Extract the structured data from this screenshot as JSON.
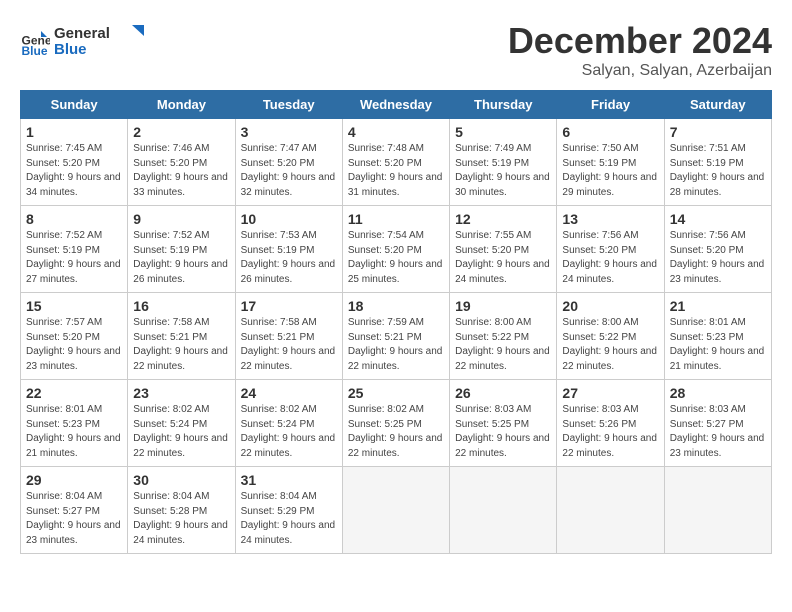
{
  "header": {
    "logo_general": "General",
    "logo_blue": "Blue",
    "month": "December 2024",
    "location": "Salyan, Salyan, Azerbaijan"
  },
  "days_of_week": [
    "Sunday",
    "Monday",
    "Tuesday",
    "Wednesday",
    "Thursday",
    "Friday",
    "Saturday"
  ],
  "weeks": [
    [
      {
        "day": "1",
        "info": "Sunrise: 7:45 AM\nSunset: 5:20 PM\nDaylight: 9 hours and 34 minutes."
      },
      {
        "day": "2",
        "info": "Sunrise: 7:46 AM\nSunset: 5:20 PM\nDaylight: 9 hours and 33 minutes."
      },
      {
        "day": "3",
        "info": "Sunrise: 7:47 AM\nSunset: 5:20 PM\nDaylight: 9 hours and 32 minutes."
      },
      {
        "day": "4",
        "info": "Sunrise: 7:48 AM\nSunset: 5:20 PM\nDaylight: 9 hours and 31 minutes."
      },
      {
        "day": "5",
        "info": "Sunrise: 7:49 AM\nSunset: 5:19 PM\nDaylight: 9 hours and 30 minutes."
      },
      {
        "day": "6",
        "info": "Sunrise: 7:50 AM\nSunset: 5:19 PM\nDaylight: 9 hours and 29 minutes."
      },
      {
        "day": "7",
        "info": "Sunrise: 7:51 AM\nSunset: 5:19 PM\nDaylight: 9 hours and 28 minutes."
      }
    ],
    [
      {
        "day": "8",
        "info": "Sunrise: 7:52 AM\nSunset: 5:19 PM\nDaylight: 9 hours and 27 minutes."
      },
      {
        "day": "9",
        "info": "Sunrise: 7:52 AM\nSunset: 5:19 PM\nDaylight: 9 hours and 26 minutes."
      },
      {
        "day": "10",
        "info": "Sunrise: 7:53 AM\nSunset: 5:19 PM\nDaylight: 9 hours and 26 minutes."
      },
      {
        "day": "11",
        "info": "Sunrise: 7:54 AM\nSunset: 5:20 PM\nDaylight: 9 hours and 25 minutes."
      },
      {
        "day": "12",
        "info": "Sunrise: 7:55 AM\nSunset: 5:20 PM\nDaylight: 9 hours and 24 minutes."
      },
      {
        "day": "13",
        "info": "Sunrise: 7:56 AM\nSunset: 5:20 PM\nDaylight: 9 hours and 24 minutes."
      },
      {
        "day": "14",
        "info": "Sunrise: 7:56 AM\nSunset: 5:20 PM\nDaylight: 9 hours and 23 minutes."
      }
    ],
    [
      {
        "day": "15",
        "info": "Sunrise: 7:57 AM\nSunset: 5:20 PM\nDaylight: 9 hours and 23 minutes."
      },
      {
        "day": "16",
        "info": "Sunrise: 7:58 AM\nSunset: 5:21 PM\nDaylight: 9 hours and 22 minutes."
      },
      {
        "day": "17",
        "info": "Sunrise: 7:58 AM\nSunset: 5:21 PM\nDaylight: 9 hours and 22 minutes."
      },
      {
        "day": "18",
        "info": "Sunrise: 7:59 AM\nSunset: 5:21 PM\nDaylight: 9 hours and 22 minutes."
      },
      {
        "day": "19",
        "info": "Sunrise: 8:00 AM\nSunset: 5:22 PM\nDaylight: 9 hours and 22 minutes."
      },
      {
        "day": "20",
        "info": "Sunrise: 8:00 AM\nSunset: 5:22 PM\nDaylight: 9 hours and 22 minutes."
      },
      {
        "day": "21",
        "info": "Sunrise: 8:01 AM\nSunset: 5:23 PM\nDaylight: 9 hours and 21 minutes."
      }
    ],
    [
      {
        "day": "22",
        "info": "Sunrise: 8:01 AM\nSunset: 5:23 PM\nDaylight: 9 hours and 21 minutes."
      },
      {
        "day": "23",
        "info": "Sunrise: 8:02 AM\nSunset: 5:24 PM\nDaylight: 9 hours and 22 minutes."
      },
      {
        "day": "24",
        "info": "Sunrise: 8:02 AM\nSunset: 5:24 PM\nDaylight: 9 hours and 22 minutes."
      },
      {
        "day": "25",
        "info": "Sunrise: 8:02 AM\nSunset: 5:25 PM\nDaylight: 9 hours and 22 minutes."
      },
      {
        "day": "26",
        "info": "Sunrise: 8:03 AM\nSunset: 5:25 PM\nDaylight: 9 hours and 22 minutes."
      },
      {
        "day": "27",
        "info": "Sunrise: 8:03 AM\nSunset: 5:26 PM\nDaylight: 9 hours and 22 minutes."
      },
      {
        "day": "28",
        "info": "Sunrise: 8:03 AM\nSunset: 5:27 PM\nDaylight: 9 hours and 23 minutes."
      }
    ],
    [
      {
        "day": "29",
        "info": "Sunrise: 8:04 AM\nSunset: 5:27 PM\nDaylight: 9 hours and 23 minutes."
      },
      {
        "day": "30",
        "info": "Sunrise: 8:04 AM\nSunset: 5:28 PM\nDaylight: 9 hours and 24 minutes."
      },
      {
        "day": "31",
        "info": "Sunrise: 8:04 AM\nSunset: 5:29 PM\nDaylight: 9 hours and 24 minutes."
      },
      {
        "day": "",
        "info": ""
      },
      {
        "day": "",
        "info": ""
      },
      {
        "day": "",
        "info": ""
      },
      {
        "day": "",
        "info": ""
      }
    ]
  ]
}
